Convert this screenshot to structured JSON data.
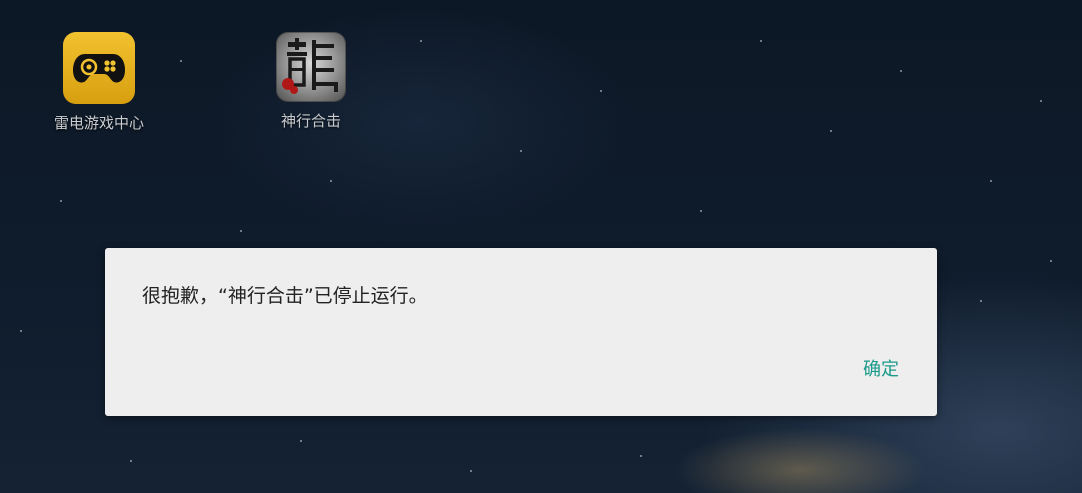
{
  "desktop": {
    "apps": [
      {
        "label": "雷电游戏中心",
        "icon": "gamepad-icon",
        "color": "#e8b21f"
      },
      {
        "label": "神行合击",
        "icon": "dragon-character-icon",
        "color": "#8d8d8d"
      }
    ]
  },
  "dialog": {
    "message": "很抱歉，“神行合击”已停止运行。",
    "ok_label": "确定",
    "button_color": "#1a9a8a"
  }
}
